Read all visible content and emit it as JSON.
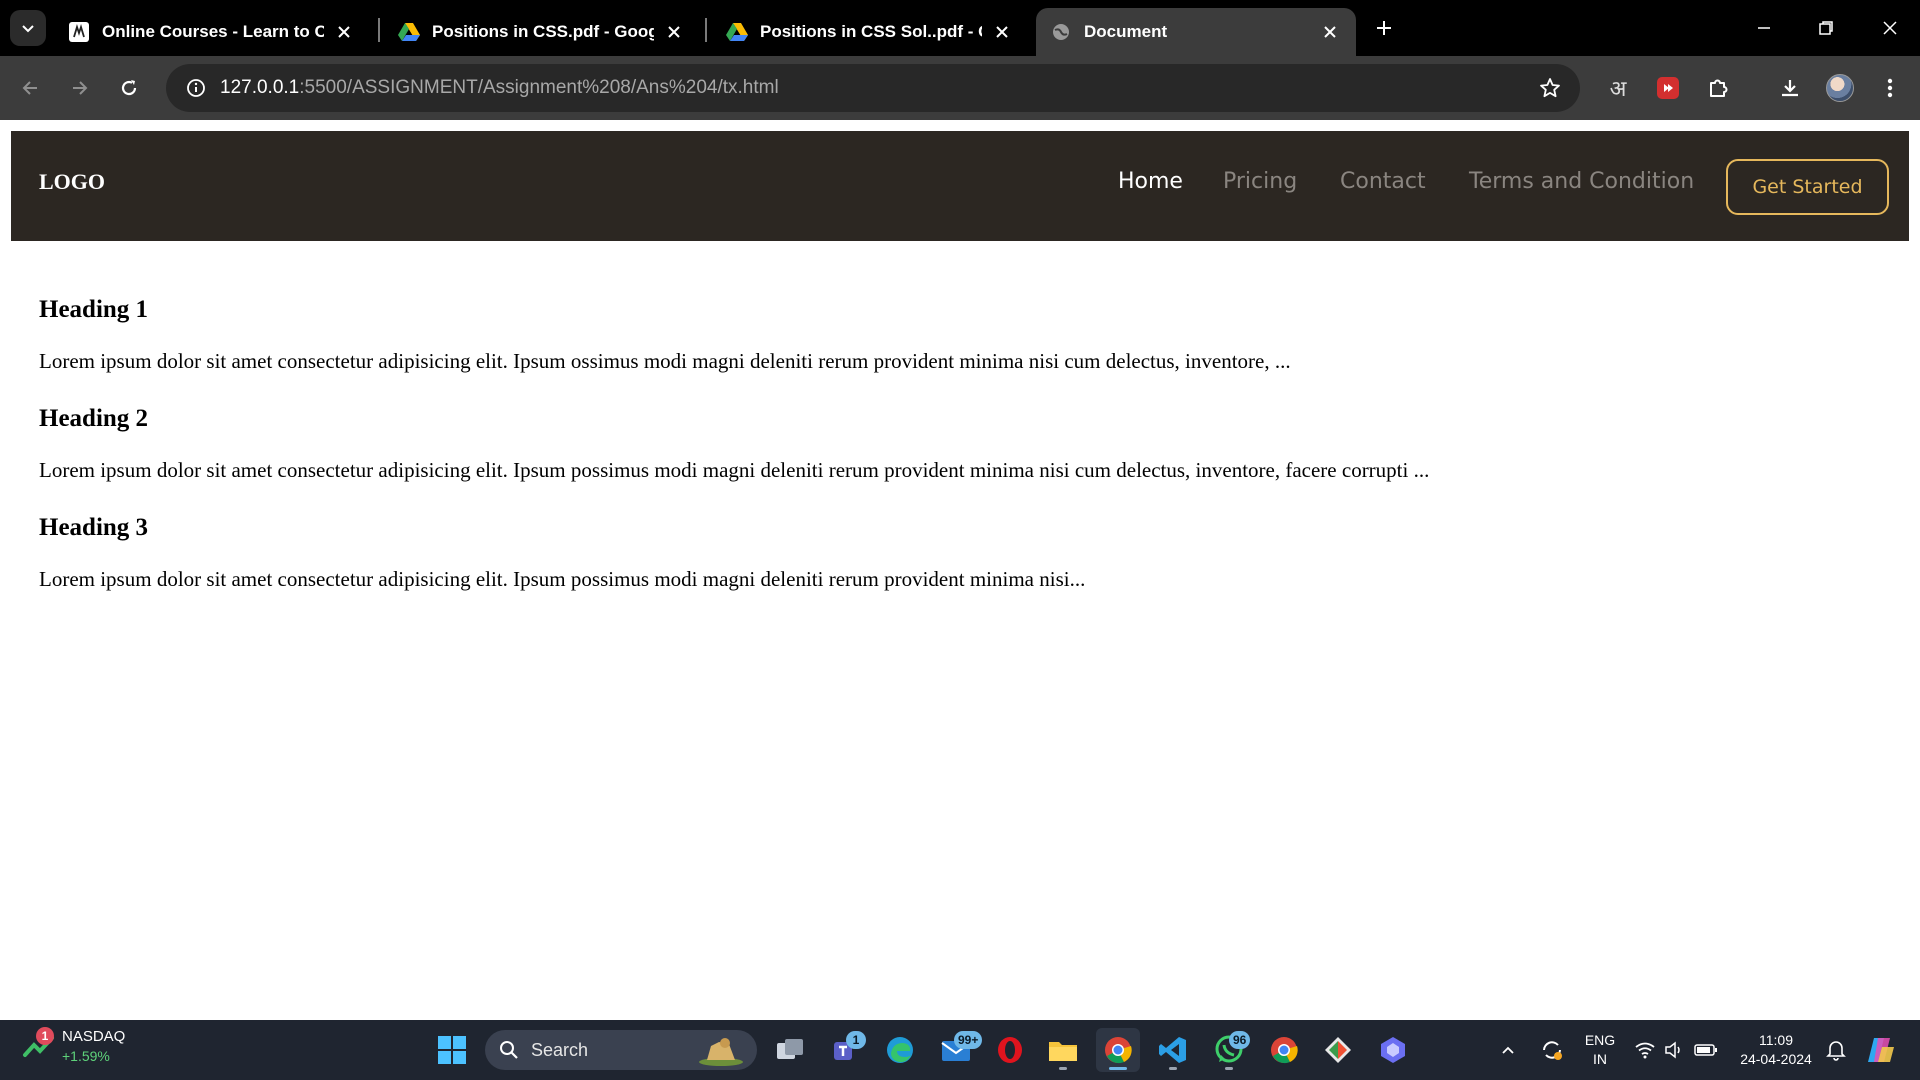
{
  "browser": {
    "tabs": [
      {
        "title": "Online Courses - Learn to Code",
        "icon": "site-favicon"
      },
      {
        "title": "Positions in CSS.pdf - Google Drive",
        "icon": "google-drive-icon"
      },
      {
        "title": "Positions in CSS Sol..pdf - Google Drive",
        "icon": "google-drive-icon"
      },
      {
        "title": "Document",
        "icon": "globe-icon",
        "active": true
      }
    ],
    "url_host": "127.0.0.1",
    "url_path": ":5500/ASSIGNMENT/Assignment%208/Ans%204/tx.html",
    "extension_hindi": "अ"
  },
  "page": {
    "logo": "LOGO",
    "nav": [
      "Home",
      "Pricing",
      "Contact",
      "Terms and Condition"
    ],
    "cta": "Get Started",
    "sections": [
      {
        "heading": "Heading 1",
        "text": "Lorem ipsum dolor sit amet consectetur adipisicing elit. Ipsum ossimus modi magni deleniti rerum provident minima nisi cum delectus, inventore, ..."
      },
      {
        "heading": "Heading 2",
        "text": "Lorem ipsum dolor sit amet consectetur adipisicing elit. Ipsum possimus modi magni deleniti rerum provident minima nisi cum delectus, inventore, facere corrupti ..."
      },
      {
        "heading": "Heading 3",
        "text": "Lorem ipsum dolor sit amet consectetur adipisicing elit. Ipsum possimus modi magni deleniti rerum provident minima nisi..."
      }
    ],
    "colors": {
      "navbar_bg": "#2c2722",
      "cta_accent": "#e6b85c",
      "nav_inactive": "#8a8580"
    }
  },
  "taskbar": {
    "widget": {
      "name": "NASDAQ",
      "change": "+1.59%",
      "badge": "1"
    },
    "search_label": "Search",
    "badges": {
      "teams": "1",
      "mail": "99+",
      "whatsapp": "96"
    },
    "language": {
      "line1": "ENG",
      "line2": "IN"
    },
    "clock": {
      "time": "11:09",
      "date": "24-04-2024"
    }
  }
}
